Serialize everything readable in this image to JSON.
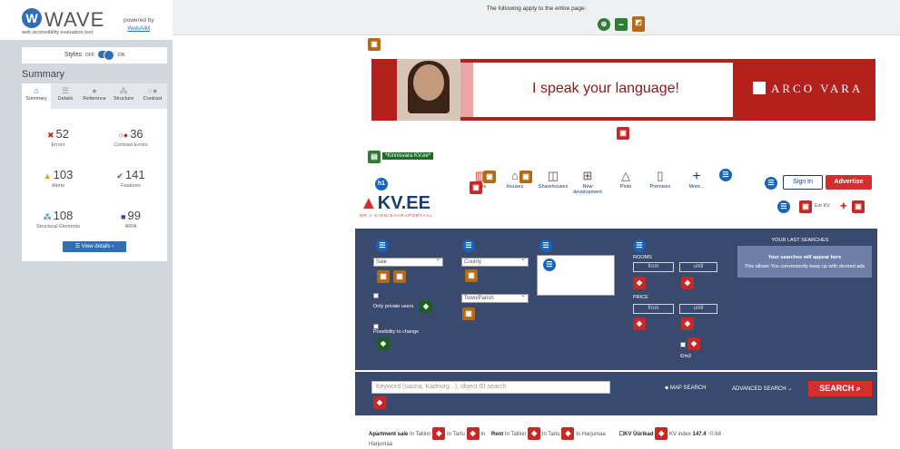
{
  "wave": {
    "logo_letter": "W",
    "title": "WAVE",
    "subtitle": "web accessibility evaluation tool",
    "powered_by": "powered by",
    "webaim": "WebAIM",
    "styles_label": "Styles:",
    "styles_off": "OFF",
    "styles_on": "ON",
    "summary_heading": "Summary",
    "tabs": [
      {
        "label": "Summary",
        "icon": "home-icon"
      },
      {
        "label": "Details",
        "icon": "list-icon"
      },
      {
        "label": "Reference",
        "icon": "info-icon"
      },
      {
        "label": "Structure",
        "icon": "structure-icon"
      },
      {
        "label": "Contrast",
        "icon": "contrast-icon"
      }
    ],
    "stats": [
      {
        "value": "52",
        "label": "Errors",
        "color": "#c62828"
      },
      {
        "value": "36",
        "label": "Contrast Errors",
        "color": "#c62828"
      },
      {
        "value": "103",
        "label": "Alerts",
        "color": "#e6a100"
      },
      {
        "value": "141",
        "label": "Features",
        "color": "#2e7d32"
      },
      {
        "value": "108",
        "label": "Structural Elements",
        "color": "#1565c0"
      },
      {
        "value": "99",
        "label": "ARIA",
        "color": "#5e35b1"
      }
    ],
    "view_details": "View details ›"
  },
  "topbar": {
    "text": "The following apply to the entire page:"
  },
  "banner": {
    "text": "I speak your language!",
    "brand": "ARCO VARA"
  },
  "kinnisvara_tag": "*Kinnisvara KV.ee*",
  "kv": {
    "h1": "h1",
    "logo_text": "KV.EE",
    "tagline": "NR 1 KINNISVARAPORTAAL",
    "nav": [
      {
        "label": "Plots",
        "icon": "apartment-icon"
      },
      {
        "label": "Houses",
        "icon": "house-icon"
      },
      {
        "label": "Sharehouses",
        "icon": "sharehouse-icon"
      },
      {
        "label": "New development",
        "icon": "new-development-icon"
      },
      {
        "label": "Plots",
        "icon": "plots-icon"
      },
      {
        "label": "Premises",
        "icon": "premises-icon"
      },
      {
        "label": "More...",
        "icon": "plus-icon"
      }
    ],
    "sign_in": "Sign In",
    "advertise": "Advertise",
    "lang": "Est KV"
  },
  "search": {
    "deal_select": "Sale",
    "county_select": "County",
    "town_select": "Town/Parish",
    "only_private": "Only private users",
    "possibility_change": "Possibility to change",
    "rooms_label": "ROOMS",
    "price_label": "PRICE",
    "from_placeholder": "from",
    "until_placeholder": "until",
    "per_m2": "€/m2",
    "last_searches_title": "YOUR LAST SEARCHES",
    "last_searches_line1": "Your searches will appear here",
    "last_searches_line2": "This allows You conveniently keep up with desired ads",
    "keyword_placeholder": "Keyword (sauna, Kadriorg...), object ID search",
    "map_search": "MAP SEARCH",
    "advanced_search": "ADVANCED SEARCH",
    "search_button": "SEARCH"
  },
  "links": {
    "apartment_sale": "Apartment sale",
    "in_tallinn": "In Tallinn",
    "in_tartu": "In Tartu",
    "in": "In",
    "rent": "Rent",
    "in_harjumaa": "In Harjumaa",
    "kv_uurikad": "KV Üürikad",
    "kv_index": "KV index",
    "kv_index_value": "147.4",
    "kv_change": "0.68",
    "harjumaa": "Harjumaa"
  }
}
